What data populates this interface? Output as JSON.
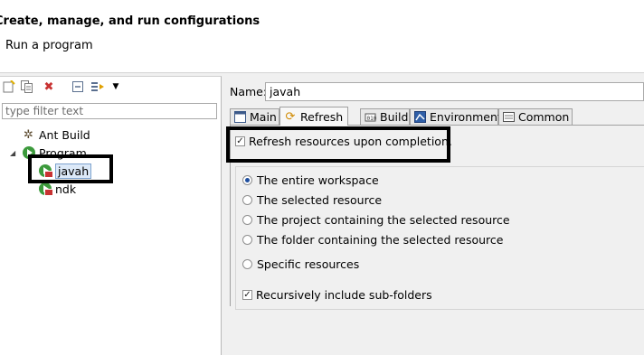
{
  "header": {
    "title": "Create, manage, and run configurations",
    "subtitle": "Run a program"
  },
  "toolbar": {
    "icons": [
      "new-config-icon",
      "duplicate-icon",
      "delete-icon",
      "collapse-all-icon",
      "filter-icon",
      "dropdown-icon"
    ]
  },
  "filter": {
    "placeholder": "type filter text",
    "value": ""
  },
  "tree": {
    "ant_build": "Ant Build",
    "program": "Program",
    "children": [
      "javah",
      "ndk"
    ]
  },
  "form": {
    "name_label": "Name:",
    "name_value": "javah"
  },
  "tabs": [
    {
      "label": "Main",
      "icon": "main-tab-icon"
    },
    {
      "label": "Refresh",
      "icon": "refresh-icon",
      "active": true
    },
    {
      "label": "Build",
      "icon": "build-icon"
    },
    {
      "label": "Environment",
      "icon": "environment-icon"
    },
    {
      "label": "Common",
      "icon": "common-icon"
    }
  ],
  "refresh": {
    "refresh_checkbox_label": "Refresh resources upon completion.",
    "refresh_checked": true,
    "options": [
      {
        "label": "The entire workspace",
        "selected": true
      },
      {
        "label": "The selected resource",
        "selected": false
      },
      {
        "label": "The project containing the selected resource",
        "selected": false
      },
      {
        "label": "The folder containing the selected resource",
        "selected": false
      }
    ],
    "specific_resources_label": "Specific resources",
    "recursive_label": "Recursively include sub-folders",
    "recursive_checked": true
  },
  "colors": {
    "selection": "#dce9f8",
    "run_green": "#3c9a3c",
    "delete_red": "#c83232"
  }
}
